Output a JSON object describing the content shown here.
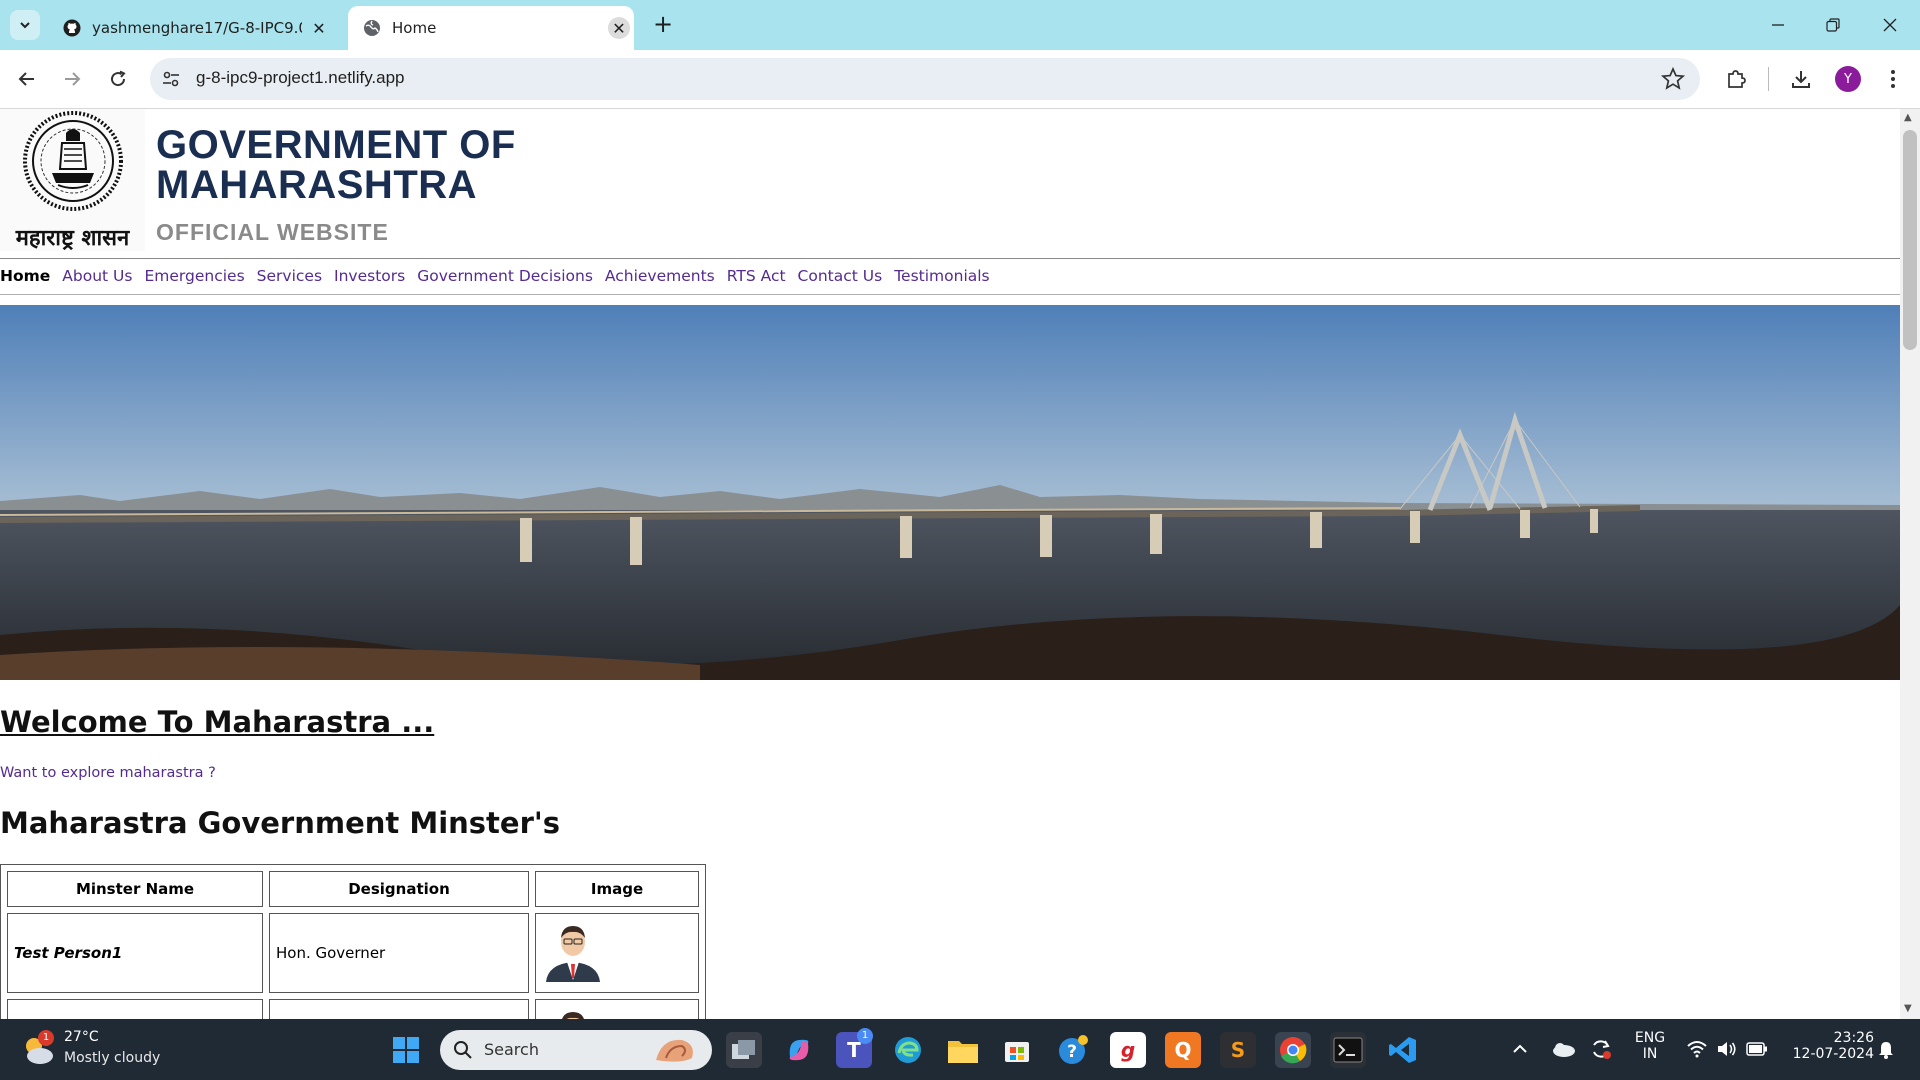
{
  "browser": {
    "tabs": [
      {
        "label": "yashmenghare17/G-8-IPC9.0-Pl",
        "favicon": "github-icon",
        "active": false
      },
      {
        "label": "Home",
        "favicon": "globe-icon",
        "active": true
      }
    ],
    "url": "g-8-ipc9-project1.netlify.app",
    "profile_initial": "Y"
  },
  "site": {
    "emblem_text": "महाराष्ट्र शासन",
    "title_line1": "GOVERNMENT OF",
    "title_line2": "MAHARASHTRA",
    "subtitle": "OFFICIAL WEBSITE",
    "nav": [
      {
        "label": "Home",
        "active": true
      },
      {
        "label": "About Us"
      },
      {
        "label": "Emergencies"
      },
      {
        "label": "Services"
      },
      {
        "label": "Investors"
      },
      {
        "label": "Government Decisions"
      },
      {
        "label": "Achievements"
      },
      {
        "label": "RTS Act"
      },
      {
        "label": "Contact Us"
      },
      {
        "label": "Testimonials"
      }
    ],
    "welcome": "Welcome To Maharastra ...",
    "explore_link": "Want to explore maharastra ?",
    "ministers_heading": "Maharastra Government Minster's",
    "table": {
      "headers": [
        "Minster Name",
        "Designation",
        "Image"
      ],
      "rows": [
        {
          "name": "Test Person1",
          "designation": "Hon. Governer"
        },
        {
          "name": "",
          "designation": ""
        }
      ]
    }
  },
  "taskbar": {
    "weather_temp": "27°C",
    "weather_desc": "Mostly cloudy",
    "weather_badge": "1",
    "search_label": "Search",
    "teams_badge": "1",
    "lang_line1": "ENG",
    "lang_line2": "IN",
    "time": "23:26",
    "date": "12-07-2024"
  },
  "colors": {
    "tabbar": "#a9e3ee",
    "title": "#1a2e52",
    "link": "#552b91",
    "taskbar": "#1f2a35"
  }
}
